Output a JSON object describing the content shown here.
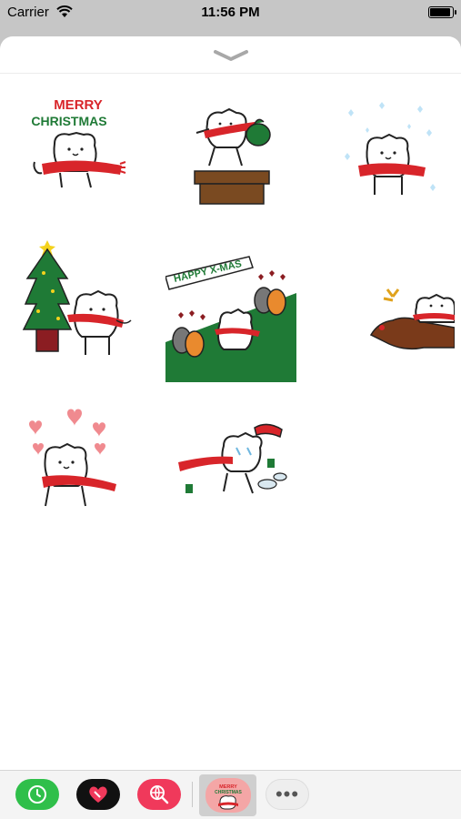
{
  "status": {
    "carrier": "Carrier",
    "time": "11:56 PM",
    "battery_level": 0.95
  },
  "icons": {
    "grabber": "chevron-down-icon",
    "wifi": "wifi-icon",
    "battery": "battery-icon"
  },
  "stickers": [
    {
      "id": "merry-christmas",
      "text_line1": "MERRY",
      "text_line2": "CHRISTMAS"
    },
    {
      "id": "gift-on-chimney"
    },
    {
      "id": "snowflakes"
    },
    {
      "id": "christmas-tree"
    },
    {
      "id": "happy-xmas-couples",
      "text": "HAPPY X-MAS"
    },
    {
      "id": "reindeer-ride"
    },
    {
      "id": "hearts-blush"
    },
    {
      "id": "melted-snowman"
    }
  ],
  "dock": {
    "apps": [
      {
        "name": "clock-app-icon",
        "color": "#2fbf4a"
      },
      {
        "name": "heart-app-icon",
        "color": "#111111"
      },
      {
        "name": "globe-search-app-icon",
        "color": "#f0395b"
      },
      {
        "name": "sticker-pack-app-icon",
        "color": "#f4a6a6",
        "selected": true,
        "label_line1": "MERRY",
        "label_line2": "CHRISTMAS"
      },
      {
        "name": "more-apps-icon",
        "color": "#eeeeee",
        "glyph": "•••"
      }
    ]
  },
  "colors": {
    "scarf": "#d8252a",
    "green": "#1f7a36",
    "accent_green": "#2fbf4a",
    "accent_pink": "#f0395b"
  }
}
